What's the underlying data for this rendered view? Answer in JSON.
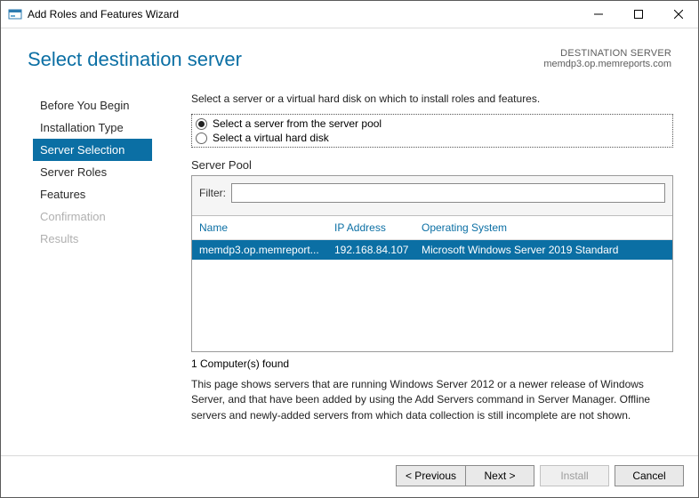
{
  "window": {
    "title": "Add Roles and Features Wizard"
  },
  "header": {
    "title": "Select destination server",
    "dest_label": "DESTINATION SERVER",
    "dest_server": "memdp3.op.memreports.com"
  },
  "sidebar": {
    "items": [
      {
        "label": "Before You Begin",
        "state": "normal"
      },
      {
        "label": "Installation Type",
        "state": "normal"
      },
      {
        "label": "Server Selection",
        "state": "active"
      },
      {
        "label": "Server Roles",
        "state": "normal"
      },
      {
        "label": "Features",
        "state": "normal"
      },
      {
        "label": "Confirmation",
        "state": "disabled"
      },
      {
        "label": "Results",
        "state": "disabled"
      }
    ]
  },
  "main": {
    "instruction": "Select a server or a virtual hard disk on which to install roles and features.",
    "radios": {
      "pool_label": "Select a server from the server pool",
      "vhd_label": "Select a virtual hard disk",
      "selected": "pool"
    },
    "section_label": "Server Pool",
    "filter": {
      "label": "Filter:",
      "value": ""
    },
    "columns": {
      "name": "Name",
      "ip": "IP Address",
      "os": "Operating System"
    },
    "rows": [
      {
        "name": "memdp3.op.memreport...",
        "ip": "192.168.84.107",
        "os": "Microsoft Windows Server 2019 Standard"
      }
    ],
    "found_text": "1 Computer(s) found",
    "note": "This page shows servers that are running Windows Server 2012 or a newer release of Windows Server, and that have been added by using the Add Servers command in Server Manager. Offline servers and newly-added servers from which data collection is still incomplete are not shown."
  },
  "footer": {
    "previous": "< Previous",
    "next": "Next >",
    "install": "Install",
    "cancel": "Cancel"
  }
}
